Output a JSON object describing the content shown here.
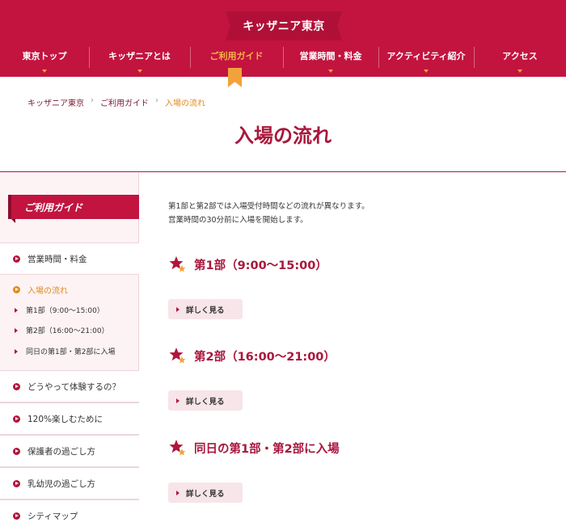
{
  "header": {
    "logo": "キッザニア東京",
    "nav": [
      "東京トップ",
      "キッザニアとは",
      "ご利用ガイド",
      "営業時間・料金",
      "アクティビティ紹介",
      "アクセス"
    ],
    "active_index": 2
  },
  "breadcrumb": [
    "キッザニア東京",
    "ご利用ガイド",
    "入場の流れ"
  ],
  "breadcrumb_sep": "›",
  "page_title": "入場の流れ",
  "sidebar": {
    "heading": "ご利用ガイド",
    "item_hours": "営業時間・料金",
    "current": "入場の流れ",
    "sub_links": [
      "第1部（9:00～15:00）",
      "第2部（16:00～21:00）",
      "同日の第1部・第2部に入場"
    ],
    "items": [
      "どうやって体験するの？",
      "120%楽しむために",
      "保護者の過ごし方",
      "乳幼児の過ごし方",
      "シティマップ"
    ]
  },
  "intro": [
    "第1部と第2部では入場受付時間などの流れが異なります。",
    "営業時間の30分前に入場を開始します。"
  ],
  "sections": [
    {
      "title": "第1部（9:00～15:00）",
      "button": "詳しく見る"
    },
    {
      "title": "第2部（16:00～21:00）",
      "button": "詳しく見る"
    },
    {
      "title": "同日の第1部・第2部に入場",
      "button": "詳しく見る"
    }
  ],
  "colors": {
    "brand": "#c2143f",
    "accent": "#f2a23a",
    "title": "#a8173c"
  }
}
